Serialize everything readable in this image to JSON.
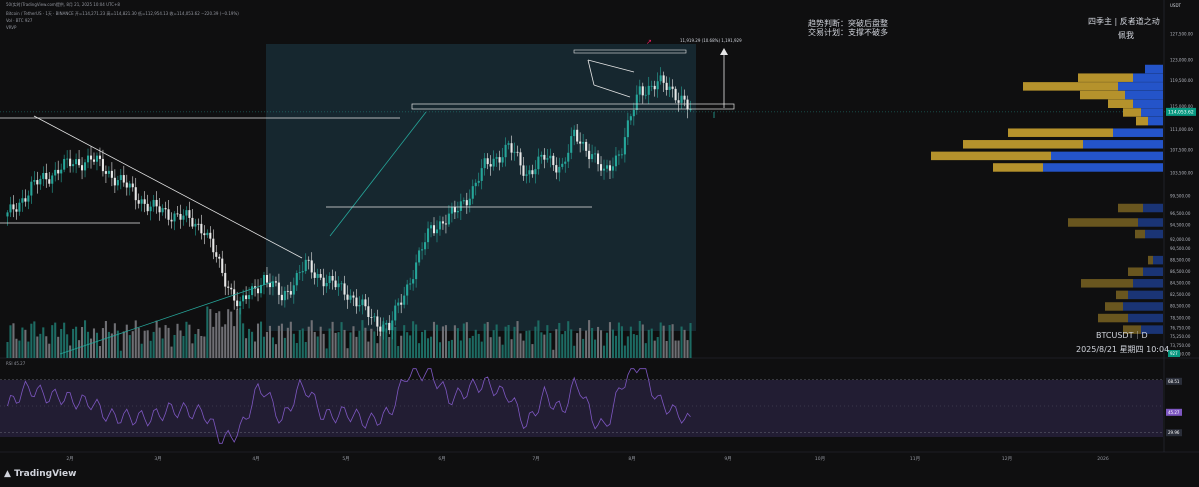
{
  "header": {
    "title_line": "50(实时)TradingView.com提供, 8月 21, 2025 10:04 UTC+8",
    "symbol_line": "Bitcoin / TetherUS · 1天 · BINANCE  开=114,271.23  高=114,821.30  低=112,954.13  收=114,053.62  −220.39 (−0.19%)",
    "volume_line": "Vol · BTC  927",
    "vrvp_line": "VRVP"
  },
  "annotations": {
    "trend": "趋势判断：突破后盘整",
    "plan": "交易计划：支撑不破多",
    "author": "四季主 | 反者道之动",
    "author_sub": "佩我",
    "ticker": "BTCUSDT｜D",
    "date": "2025/8/21 星期四 10:04",
    "measure_box": "11,919.29 (10.68%) 1,191,929"
  },
  "footer": {
    "logo_text": "TradingView"
  },
  "colors": {
    "up": "#26a69a",
    "down": "#e8e8e8",
    "background": "#0f0f10",
    "shade": "#172a33",
    "rsi_band": "#221d33",
    "rsi_line": "#7e57c2",
    "vp_up": "#2454c9",
    "vp_down": "#b5922c",
    "price_tag": "#089981"
  },
  "chart_data": [
    {
      "type": "candlestick",
      "unit": "USDT",
      "yticks": [
        "127,500.00",
        "123,000.00",
        "119,500.00",
        "115,000.00",
        "111,000.00",
        "107,500.00",
        "103,500.00",
        "99,500.00",
        "96,500.00",
        "94,500.00",
        "92,000.00",
        "90,500.00",
        "88,500.00",
        "86,500.00",
        "84,500.00",
        "82,500.00",
        "80,500.00",
        "78,500.00",
        "76,750.00",
        "75,250.00",
        "73,750.00",
        "72,250.00"
      ],
      "ylim": [
        72250,
        127500
      ],
      "xticks": [
        "2月",
        "3月",
        "4月",
        "5月",
        "6月",
        "7月",
        "8月",
        "9月",
        "10月",
        "11月",
        "12月",
        "2026"
      ],
      "last_price": "114,053.62",
      "last_volume": "927",
      "ohlc_monthly_anchors": [
        {
          "x": "2025-01",
          "o": 93000,
          "h": 109500,
          "l": 90000,
          "c": 102500
        },
        {
          "x": "2025-02",
          "o": 102500,
          "h": 106000,
          "l": 78500,
          "c": 84500
        },
        {
          "x": "2025-03",
          "o": 84500,
          "h": 95000,
          "l": 76600,
          "c": 82500
        },
        {
          "x": "2025-04",
          "o": 82500,
          "h": 95700,
          "l": 74500,
          "c": 94200
        },
        {
          "x": "2025-05",
          "o": 94200,
          "h": 111900,
          "l": 93300,
          "c": 104600
        },
        {
          "x": "2025-06",
          "o": 104600,
          "h": 110400,
          "l": 98200,
          "c": 107100
        },
        {
          "x": "2025-07",
          "o": 107100,
          "h": 123200,
          "l": 105300,
          "c": 115700
        },
        {
          "x": "2025-08",
          "o": 115700,
          "h": 124500,
          "l": 112300,
          "c": 114050
        }
      ],
      "horizontal_levels": [
        110100,
        111700,
        92800,
        109000,
        90000
      ],
      "volume_profile": [
        {
          "price": 121500,
          "up": 18,
          "down": 0
        },
        {
          "price": 120000,
          "up": 30,
          "down": 55
        },
        {
          "price": 118500,
          "up": 45,
          "down": 95
        },
        {
          "price": 117000,
          "up": 38,
          "down": 45
        },
        {
          "price": 115500,
          "up": 30,
          "down": 25
        },
        {
          "price": 114000,
          "up": 22,
          "down": 18
        },
        {
          "price": 112500,
          "up": 15,
          "down": 12
        },
        {
          "price": 110500,
          "up": 50,
          "down": 105
        },
        {
          "price": 108500,
          "up": 80,
          "down": 120
        },
        {
          "price": 106500,
          "up": 112,
          "down": 120
        },
        {
          "price": 104500,
          "up": 120,
          "down": 50
        },
        {
          "price": 97500,
          "up": 20,
          "down": 25
        },
        {
          "price": 95000,
          "up": 25,
          "down": 70
        },
        {
          "price": 93000,
          "up": 18,
          "down": 10
        },
        {
          "price": 88500,
          "up": 10,
          "down": 5
        },
        {
          "price": 86500,
          "up": 20,
          "down": 15
        },
        {
          "price": 84500,
          "up": 30,
          "down": 52
        },
        {
          "price": 82500,
          "up": 35,
          "down": 12
        },
        {
          "price": 80500,
          "up": 40,
          "down": 18
        },
        {
          "price": 78500,
          "up": 35,
          "down": 30
        },
        {
          "price": 76500,
          "up": 22,
          "down": 18
        }
      ]
    },
    {
      "type": "line",
      "name": "RSI",
      "value_label": "45.27",
      "yticks": [
        "68.51",
        "45.27",
        "29.96"
      ],
      "ylim": [
        20,
        80
      ]
    }
  ]
}
